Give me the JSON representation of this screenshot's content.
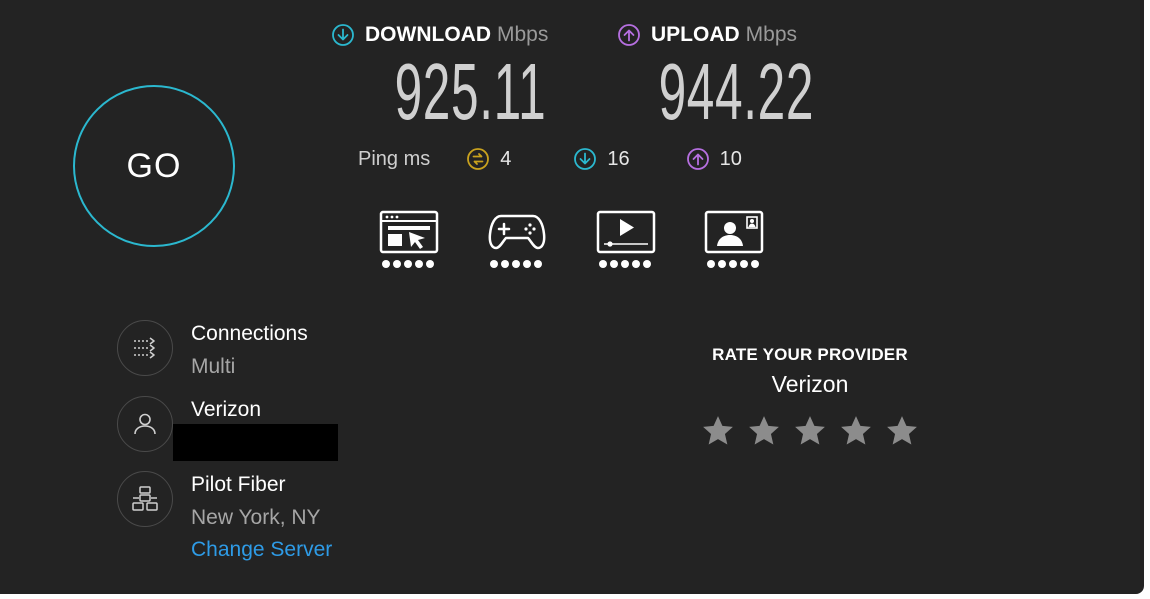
{
  "go_button": {
    "label": "GO"
  },
  "download": {
    "label": "DOWNLOAD",
    "unit": "Mbps",
    "value": "925.11",
    "color": "#2bb8cf"
  },
  "upload": {
    "label": "UPLOAD",
    "unit": "Mbps",
    "value": "944.22",
    "color": "#b66fe0"
  },
  "ping": {
    "label": "Ping",
    "unit": "ms",
    "idle": {
      "value": "4",
      "color": "#c9a21e"
    },
    "download": {
      "value": "16",
      "color": "#2bb8cf"
    },
    "upload": {
      "value": "10",
      "color": "#b66fe0"
    }
  },
  "use_cases": [
    {
      "icon": "web-browsing-icon",
      "rating": 5
    },
    {
      "icon": "gaming-icon",
      "rating": 5
    },
    {
      "icon": "streaming-icon",
      "rating": 5
    },
    {
      "icon": "video-chat-icon",
      "rating": 5
    }
  ],
  "connections": {
    "title": "Connections",
    "value": "Multi"
  },
  "isp": {
    "title": "Verizon"
  },
  "server": {
    "title": "Pilot Fiber",
    "location": "New York, NY",
    "change_label": "Change Server"
  },
  "rate_provider": {
    "title": "RATE YOUR PROVIDER",
    "provider": "Verizon",
    "stars": 5,
    "star_color": "#8c8c8c"
  }
}
